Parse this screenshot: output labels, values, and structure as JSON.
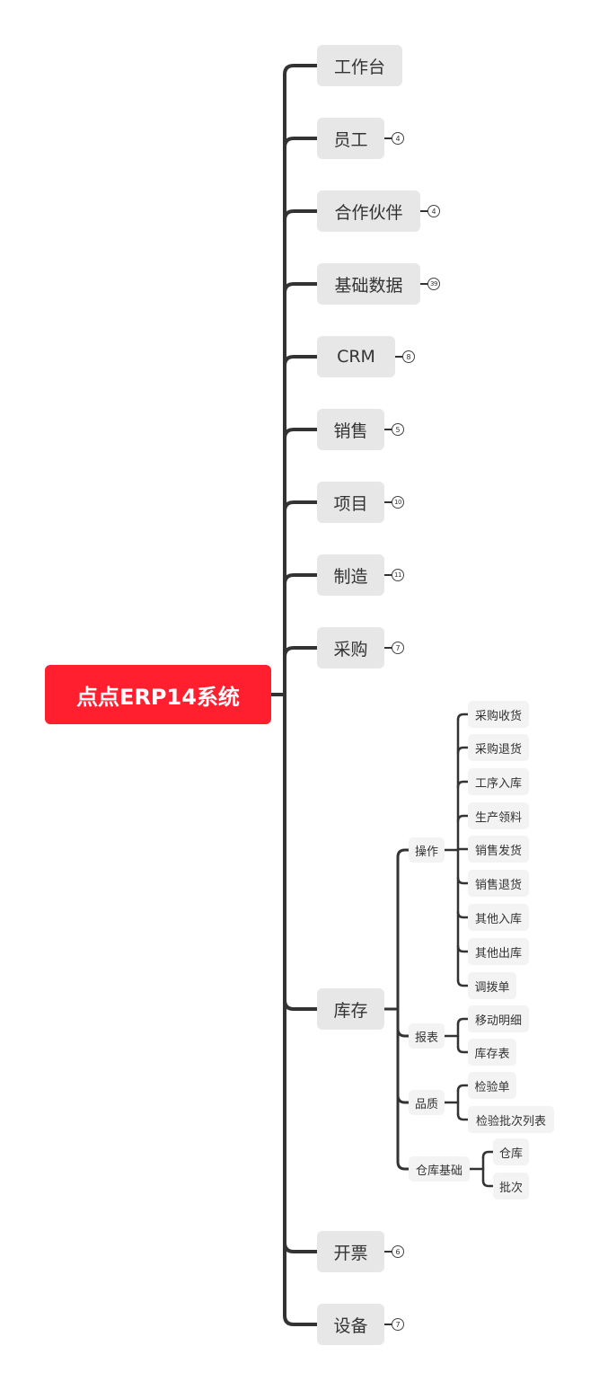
{
  "root": {
    "label": "点点ERP14系统"
  },
  "branches": [
    {
      "label": "工作台",
      "count": null
    },
    {
      "label": "员工",
      "count": "4"
    },
    {
      "label": "合作伙伴",
      "count": "4"
    },
    {
      "label": "基础数据",
      "count": "39"
    },
    {
      "label": "CRM",
      "count": "8"
    },
    {
      "label": "销售",
      "count": "5"
    },
    {
      "label": "项目",
      "count": "10"
    },
    {
      "label": "制造",
      "count": "11"
    },
    {
      "label": "采购",
      "count": "7"
    },
    {
      "label": "库存",
      "count": null,
      "children": [
        {
          "label": "操作",
          "children": [
            "采购收货",
            "采购退货",
            "工序入库",
            "生产领料",
            "销售发货",
            "销售退货",
            "其他入库",
            "其他出库",
            "调拨单"
          ]
        },
        {
          "label": "报表",
          "children": [
            "移动明细",
            "库存表"
          ]
        },
        {
          "label": "品质",
          "children": [
            "检验单",
            "检验批次列表"
          ]
        },
        {
          "label": "仓库基础",
          "children": [
            "仓库",
            "批次"
          ]
        }
      ]
    },
    {
      "label": "开票",
      "count": "6"
    },
    {
      "label": "设备",
      "count": "7"
    }
  ]
}
